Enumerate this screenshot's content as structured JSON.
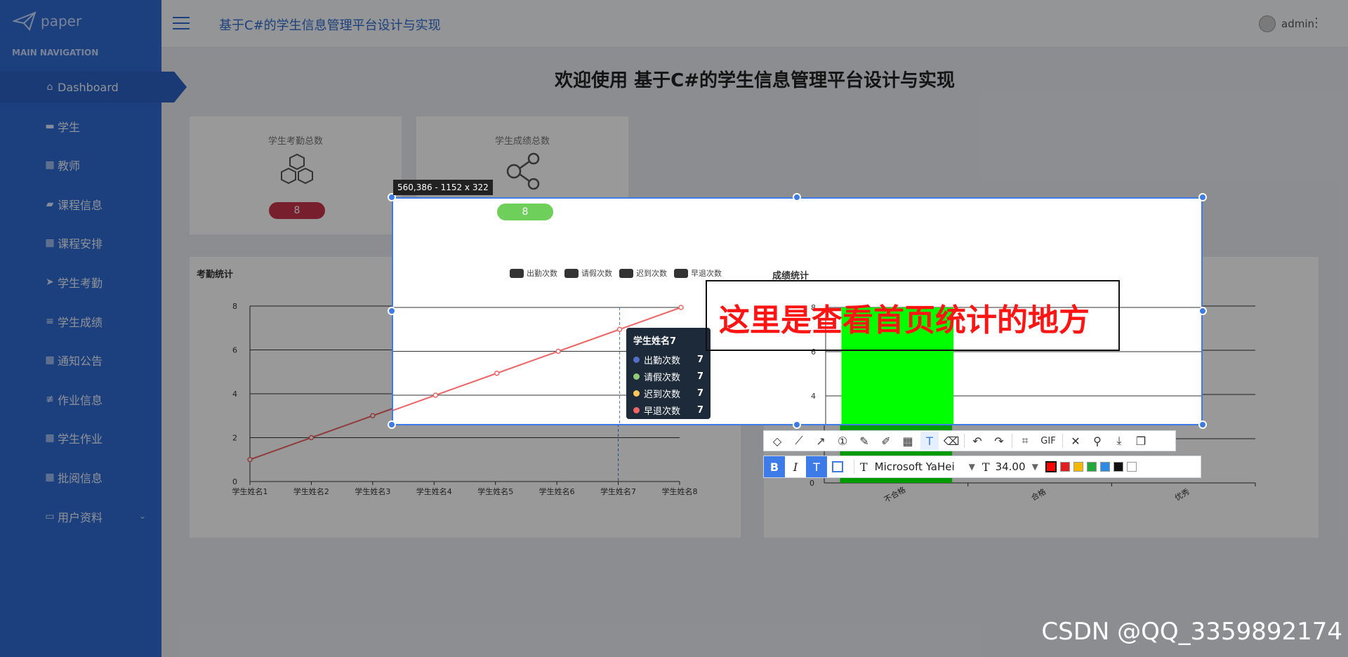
{
  "sidebar": {
    "logo_text": "paper",
    "nav_title": "MAIN NAVIGATION",
    "items": [
      {
        "label": "Dashboard",
        "icon": "home-icon"
      },
      {
        "label": "学生",
        "icon": "chat-icon"
      },
      {
        "label": "教师",
        "icon": "grid-icon"
      },
      {
        "label": "课程信息",
        "icon": "briefcase-icon"
      },
      {
        "label": "课程安排",
        "icon": "grid-icon"
      },
      {
        "label": "学生考勤",
        "icon": "send-icon"
      },
      {
        "label": "学生成绩",
        "icon": "list-icon"
      },
      {
        "label": "通知公告",
        "icon": "grid-icon"
      },
      {
        "label": "作业信息",
        "icon": "sliders-icon"
      },
      {
        "label": "学生作业",
        "icon": "grid-icon"
      },
      {
        "label": "批阅信息",
        "icon": "grid-icon"
      },
      {
        "label": "用户资料",
        "icon": "card-icon"
      }
    ]
  },
  "header": {
    "site_title": "基于C#的学生信息管理平台设计与实现",
    "username": "admin"
  },
  "main": {
    "welcome": "欢迎使用 基于C#的学生信息管理平台设计与实现",
    "cards": [
      {
        "label": "学生考勤总数",
        "value": "8",
        "color": "#c9344b"
      },
      {
        "label": "学生成绩总数",
        "value": "8",
        "color": "#6fcf5b"
      }
    ]
  },
  "attendance_chart": {
    "title": "考勤统计",
    "legend": [
      "出勤次数",
      "请假次数",
      "迟到次数",
      "早退次数"
    ],
    "tooltip": {
      "title": "学生姓名7",
      "rows": [
        {
          "label": "出勤次数",
          "value": "7",
          "color": "#5470c6"
        },
        {
          "label": "请假次数",
          "value": "7",
          "color": "#91cc75"
        },
        {
          "label": "迟到次数",
          "value": "7",
          "color": "#fac858"
        },
        {
          "label": "早退次数",
          "value": "7",
          "color": "#ee6666"
        }
      ]
    }
  },
  "score_chart": {
    "title": "成绩统计"
  },
  "screenshot_tool": {
    "size_label": "560,386 - 1152 x 322",
    "annotation": "这里是查看首页统计的地方",
    "font_name": "Microsoft YaHei",
    "font_size": "34.00",
    "gif_label": "GIF",
    "palette": [
      "#ff0000",
      "#e02020",
      "#f5b800",
      "#22a83a",
      "#2f8ae6",
      "#111111",
      "#ffffff"
    ]
  },
  "watermark": "CSDN @QQ_3359892174",
  "chart_data": [
    {
      "type": "line",
      "title": "考勤统计",
      "categories": [
        "学生姓名1",
        "学生姓名2",
        "学生姓名3",
        "学生姓名4",
        "学生姓名5",
        "学生姓名6",
        "学生姓名7",
        "学生姓名8"
      ],
      "series": [
        {
          "name": "出勤次数",
          "values": [
            1,
            2,
            3,
            4,
            5,
            6,
            7,
            8
          ]
        },
        {
          "name": "请假次数",
          "values": [
            1,
            2,
            3,
            4,
            5,
            6,
            7,
            8
          ]
        },
        {
          "name": "迟到次数",
          "values": [
            1,
            2,
            3,
            4,
            5,
            6,
            7,
            8
          ]
        },
        {
          "name": "早退次数",
          "values": [
            1,
            2,
            3,
            4,
            5,
            6,
            7,
            8
          ]
        }
      ],
      "ylim": [
        0,
        8
      ],
      "yticks": [
        0,
        2,
        4,
        6,
        8
      ],
      "grid": true,
      "legend_position": "top-right"
    },
    {
      "type": "bar",
      "title": "成绩统计",
      "categories": [
        "不合格",
        "合格",
        "优秀"
      ],
      "values": [
        8,
        0,
        0
      ],
      "ylim": [
        0,
        8
      ],
      "yticks": [
        0,
        2,
        4,
        6,
        8
      ],
      "bar_color": "#00ff00"
    }
  ]
}
